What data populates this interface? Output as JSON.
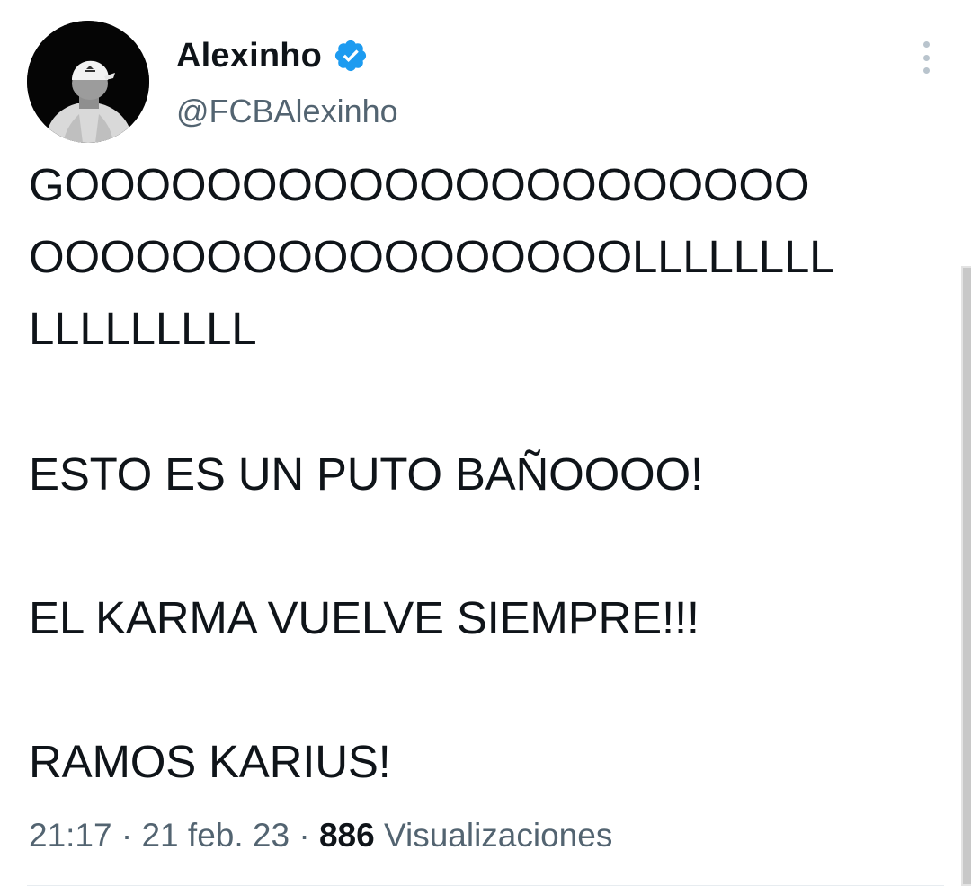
{
  "author": {
    "display_name": "Alexinho",
    "handle": "@FCBAlexinho",
    "verified": true,
    "avatar_icon": "avatar-photo"
  },
  "tweet": {
    "lines": [
      "GOOOOOOOOOOOOOOOOOOOOO",
      "OOOOOOOOOOOOOOOOOLLLLLLLL",
      "LLLLLLLLL",
      "ESTO ES UN PUTO BAÑOOOO!",
      "EL KARMA VUELVE SIEMPRE!!!",
      "RAMOS KARIUS!"
    ]
  },
  "meta": {
    "time": "21:17",
    "separator": " · ",
    "date": "21 feb. 23",
    "views_count": "886",
    "views_label": " Visualizaciones"
  },
  "colors": {
    "verified_badge": "#1d9bf0",
    "text_primary": "#0f1419",
    "text_secondary": "#536471"
  },
  "icons": {
    "verified": "verified-badge-icon",
    "more": "more-options-icon"
  }
}
